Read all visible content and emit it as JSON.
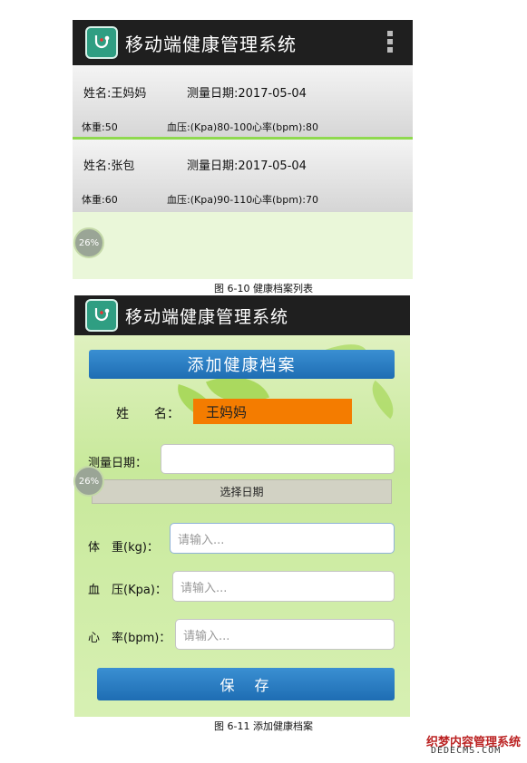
{
  "screen1": {
    "app_title": "移动端健康管理系统",
    "records": [
      {
        "name": "姓名:王妈妈",
        "date": "测量日期:2017-05-04",
        "weight": "体重:50",
        "bp": "血压:(Kpa)80-100",
        "hr": "心率(bpm):80"
      },
      {
        "name": "姓名:张包",
        "date": "测量日期:2017-05-04",
        "weight": "体重:60",
        "bp": "血压:(Kpa)90-110",
        "hr": "心率(bpm):70"
      }
    ],
    "badge": "26%"
  },
  "caption1": "图 6-10 健康档案列表",
  "screen2": {
    "app_title": "移动端健康管理系统",
    "header": "添加健康档案",
    "name_label": "姓　　名：",
    "name_value": "王妈妈",
    "date_label": "测量日期：",
    "date_value": "",
    "choose_date": "选择日期",
    "badge": "26%",
    "weight_label": "体　重(kg)：",
    "bp_label": "血　压(Kpa)：",
    "hr_label": "心　率(bpm)：",
    "placeholder": "请输入...",
    "save": "保　存"
  },
  "caption2": "图 6-11 添加健康档案",
  "watermark": {
    "line1": "织梦内容管理系统",
    "line2": "DEDECMS.COM"
  },
  "colors": {
    "appbar": "#1f1f1f",
    "accent_blue": "#2276be",
    "name_orange": "#f47c00",
    "screen_green": "#c8e99b"
  }
}
